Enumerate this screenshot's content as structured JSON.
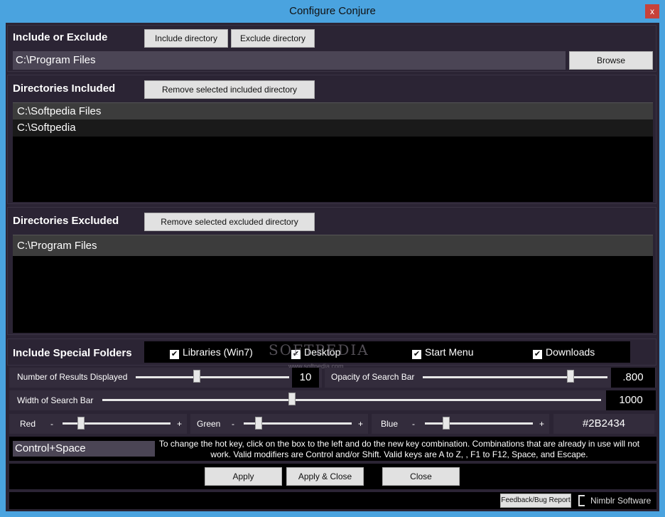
{
  "window": {
    "title": "Configure Conjure",
    "close_glyph": "x"
  },
  "include_exclude": {
    "title": "Include or Exclude",
    "include_btn": "Include directory",
    "exclude_btn": "Exclude directory",
    "path_value": "C:\\Program Files",
    "browse_btn": "Browse"
  },
  "included": {
    "title": "Directories Included",
    "remove_btn": "Remove selected included directory",
    "items": [
      "C:\\Softpedia Files",
      "C:\\Softpedia"
    ]
  },
  "excluded": {
    "title": "Directories Excluded",
    "remove_btn": "Remove selected excluded directory",
    "items": [
      "C:\\Program Files"
    ]
  },
  "special": {
    "title": "Include Special Folders",
    "options": [
      {
        "label": "Libraries (Win7)",
        "checked": true
      },
      {
        "label": "Desktop",
        "checked": true
      },
      {
        "label": "Start Menu",
        "checked": true
      },
      {
        "label": "Downloads",
        "checked": true
      }
    ]
  },
  "watermark": {
    "main": "SOFTPEDIA",
    "sub": "www.softpedia.com"
  },
  "sliders": {
    "results": {
      "label": "Number of Results Displayed",
      "value": "10",
      "level": 0.4
    },
    "opacity": {
      "label": "Opacity of Search Bar",
      "value": ".800",
      "level": 0.8
    },
    "width": {
      "label": "Width of Search Bar",
      "value": "1000",
      "level": 0.38
    },
    "red": {
      "label": "Red",
      "level": 0.17
    },
    "green": {
      "label": "Green",
      "level": 0.14
    },
    "blue": {
      "label": "Blue",
      "level": 0.2
    },
    "minus": "-",
    "plus": "+",
    "color_hex": "#2B2434"
  },
  "hotkey": {
    "value": "Control+Space",
    "hint": "To change the hot key, click on the box to the left and do the new key combination. Combinations that are already in use will not work. Valid modifiers are Control and/or Shift. Valid keys are A to Z, , F1 to F12, Space, and Escape."
  },
  "actions": {
    "apply": "Apply",
    "apply_close": "Apply & Close",
    "close": "Close"
  },
  "footer": {
    "feedback": "Feedback/Bug Report",
    "brand": "Nimblr Software"
  },
  "colors": {
    "background": "#2b2434",
    "titlebar": "#4aa3df",
    "close": "#c7423a"
  }
}
